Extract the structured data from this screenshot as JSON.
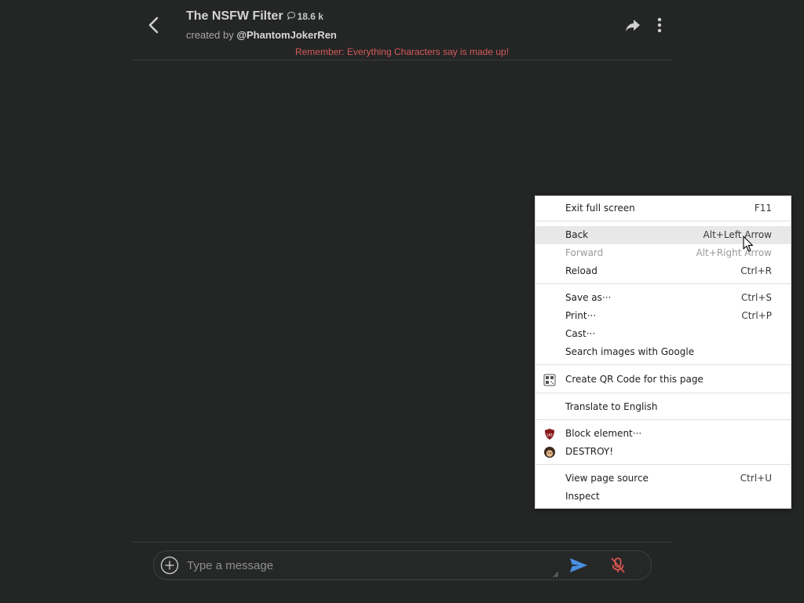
{
  "header": {
    "title": "The NSFW Filter",
    "interaction_count": "18.6 k",
    "creator_prefix": "created by ",
    "creator_handle": "@PhantomJokerRen",
    "disclaimer": "Remember: Everything Characters say is made up!"
  },
  "composer": {
    "placeholder": "Type a message"
  },
  "context_menu": {
    "items": [
      {
        "label": "Exit full screen",
        "shortcut": "F11"
      },
      {
        "label": "Back",
        "shortcut": "Alt+Left Arrow"
      },
      {
        "label": "Forward",
        "shortcut": "Alt+Right Arrow"
      },
      {
        "label": "Reload",
        "shortcut": "Ctrl+R"
      },
      {
        "label": "Save as···",
        "shortcut": "Ctrl+S"
      },
      {
        "label": "Print···",
        "shortcut": "Ctrl+P"
      },
      {
        "label": "Cast···",
        "shortcut": ""
      },
      {
        "label": "Search images with Google",
        "shortcut": ""
      },
      {
        "label": "Create QR Code for this page",
        "shortcut": ""
      },
      {
        "label": "Translate to English",
        "shortcut": ""
      },
      {
        "label": "Block element···",
        "shortcut": ""
      },
      {
        "label": "DESTROY!",
        "shortcut": ""
      },
      {
        "label": "View page source",
        "shortcut": "Ctrl+U"
      },
      {
        "label": "Inspect",
        "shortcut": ""
      }
    ]
  },
  "colors": {
    "background": "#242525",
    "disclaimer": "#d45a5a",
    "send_icon": "#4a90e2",
    "mic_off_icon": "#d9534f",
    "menu_hover": "#e8e8e8"
  },
  "icons": [
    "back-arrow-icon",
    "chat-bubble-icon",
    "share-icon",
    "more-vertical-icon",
    "add-circle-icon",
    "send-icon",
    "mic-off-icon",
    "qr-code-icon",
    "ublock-icon",
    "avatar-icon",
    "mouse-cursor-icon"
  ]
}
